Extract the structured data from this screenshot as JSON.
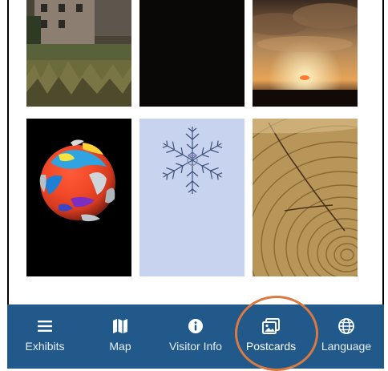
{
  "nav": {
    "items": [
      {
        "label": "Exhibits",
        "icon": "menu-icon"
      },
      {
        "label": "Map",
        "icon": "map-icon"
      },
      {
        "label": "Visitor Info",
        "icon": "info-icon"
      },
      {
        "label": "Postcards",
        "icon": "image-icon",
        "active": true
      },
      {
        "label": "Language",
        "icon": "globe-icon"
      }
    ]
  },
  "postcards": [
    {
      "subject": "building-and-grass"
    },
    {
      "subject": "black"
    },
    {
      "subject": "sunset-clouds"
    },
    {
      "subject": "earth-temperature-globe"
    },
    {
      "subject": "snowflake"
    },
    {
      "subject": "tree-rings"
    }
  ],
  "colors": {
    "nav_background": "#20598a",
    "highlight": "#d97a42"
  }
}
